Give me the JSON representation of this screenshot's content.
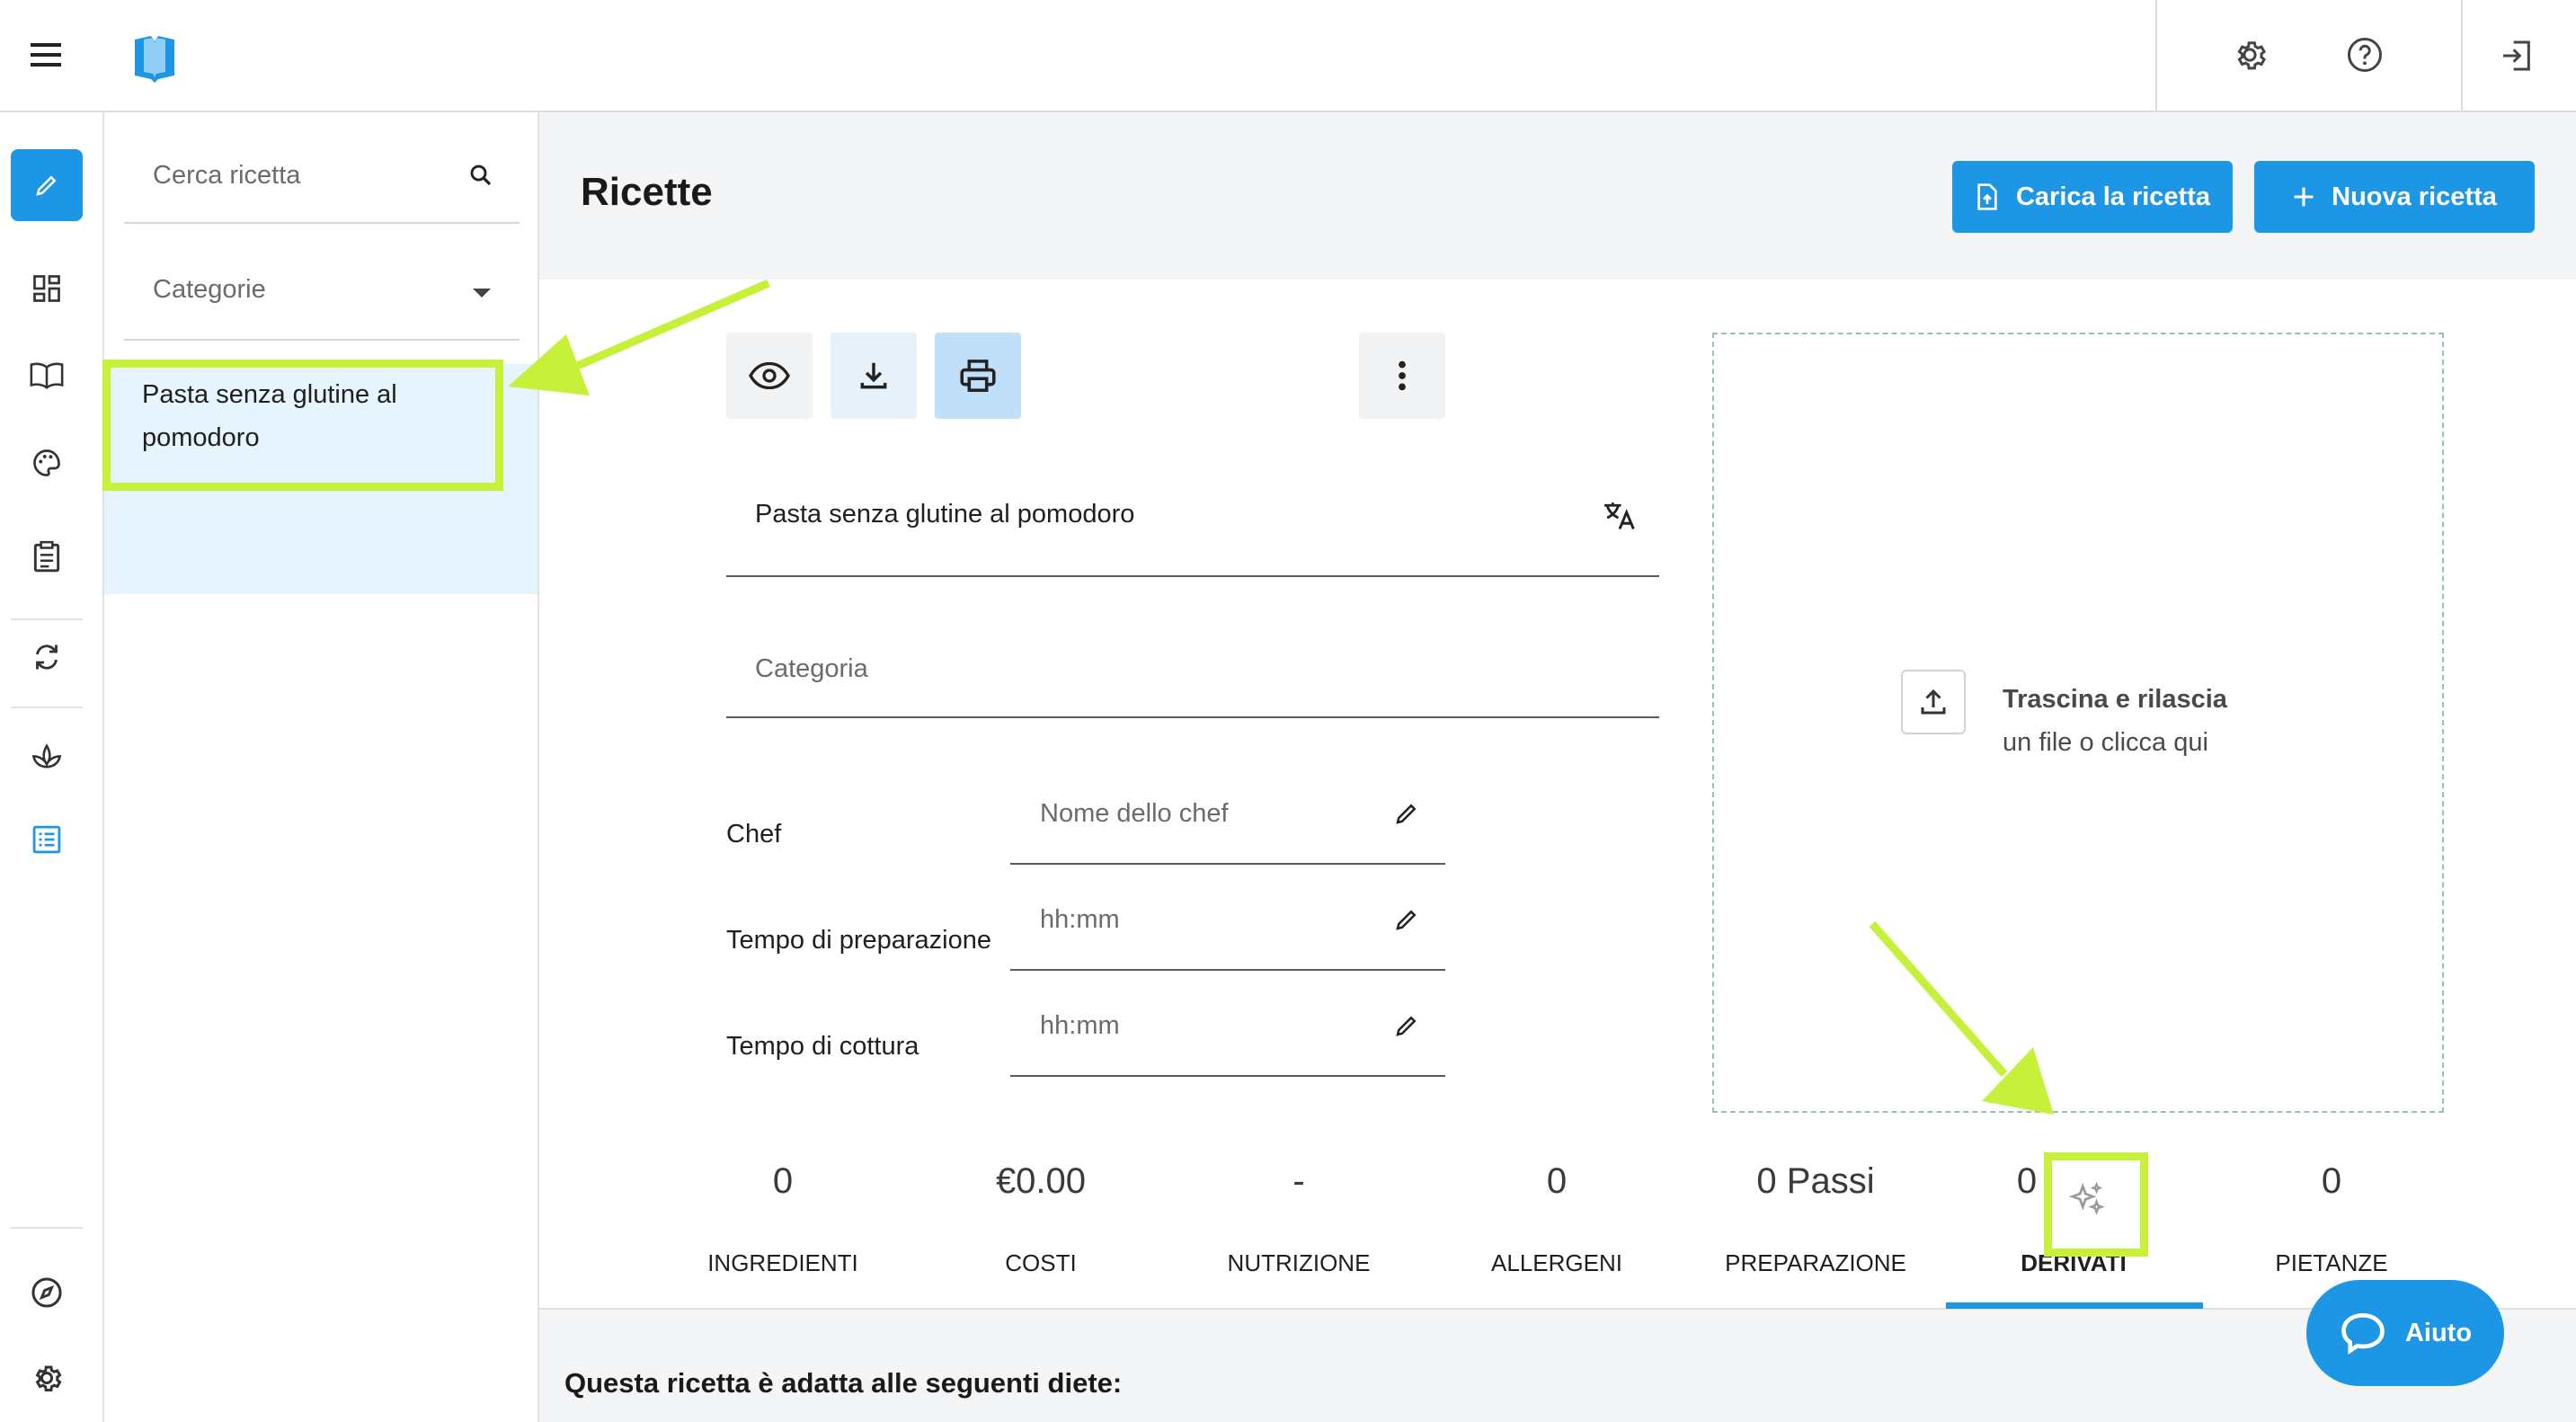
{
  "app": {
    "logo": "book-logo",
    "title": "Ricette"
  },
  "topbar": {
    "menu_icon": "hamburger-icon",
    "settings_icon": "gear-icon",
    "help_icon": "help-circle-icon",
    "logout_icon": "logout-icon"
  },
  "rail": {
    "items": [
      "pencil-icon",
      "dashboard-icon",
      "book-icon",
      "palette-icon",
      "clipboard-icon",
      "sync-icon",
      "leaf-icon",
      "list-icon",
      "compass-icon",
      "settings-icon"
    ],
    "active": "pencil-icon"
  },
  "list": {
    "search_placeholder": "Cerca ricetta",
    "category_placeholder": "Categorie",
    "items": [
      {
        "label": "Pasta senza glutine al pomodoro"
      }
    ]
  },
  "header": {
    "upload_button": "Carica la ricetta",
    "new_button": "Nuova ricetta"
  },
  "form": {
    "recipe_name": "Pasta senza glutine al pomodoro",
    "category_placeholder": "Categoria",
    "chef_label": "Chef",
    "chef_placeholder": "Nome dello chef",
    "prep_label": "Tempo di preparazione",
    "prep_placeholder": "hh:mm",
    "cook_label": "Tempo di cottura",
    "cook_placeholder": "hh:mm"
  },
  "dropzone": {
    "title": "Trascina e rilascia",
    "subtitle": "un file o clicca qui"
  },
  "stats": [
    {
      "value": "0",
      "label": "INGREDIENTI"
    },
    {
      "value": "€0.00",
      "label": "COSTI"
    },
    {
      "value": "-",
      "label": "NUTRIZIONE"
    },
    {
      "value": "0",
      "label": "ALLERGENI"
    },
    {
      "value": "0 Passi",
      "label": "PREPARAZIONE"
    },
    {
      "value": "0",
      "label": "DERIVATI"
    },
    {
      "value": "0",
      "label": "PIETANZE"
    }
  ],
  "active_tab": "DERIVATI",
  "diet_heading": "Questa ricetta è adatta alle seguenti diete:",
  "help_button": "Aiuto",
  "colors": {
    "accent": "#1e96e6",
    "highlight": "#c6f03a",
    "selected_item_bg": "#e6f4fd"
  }
}
